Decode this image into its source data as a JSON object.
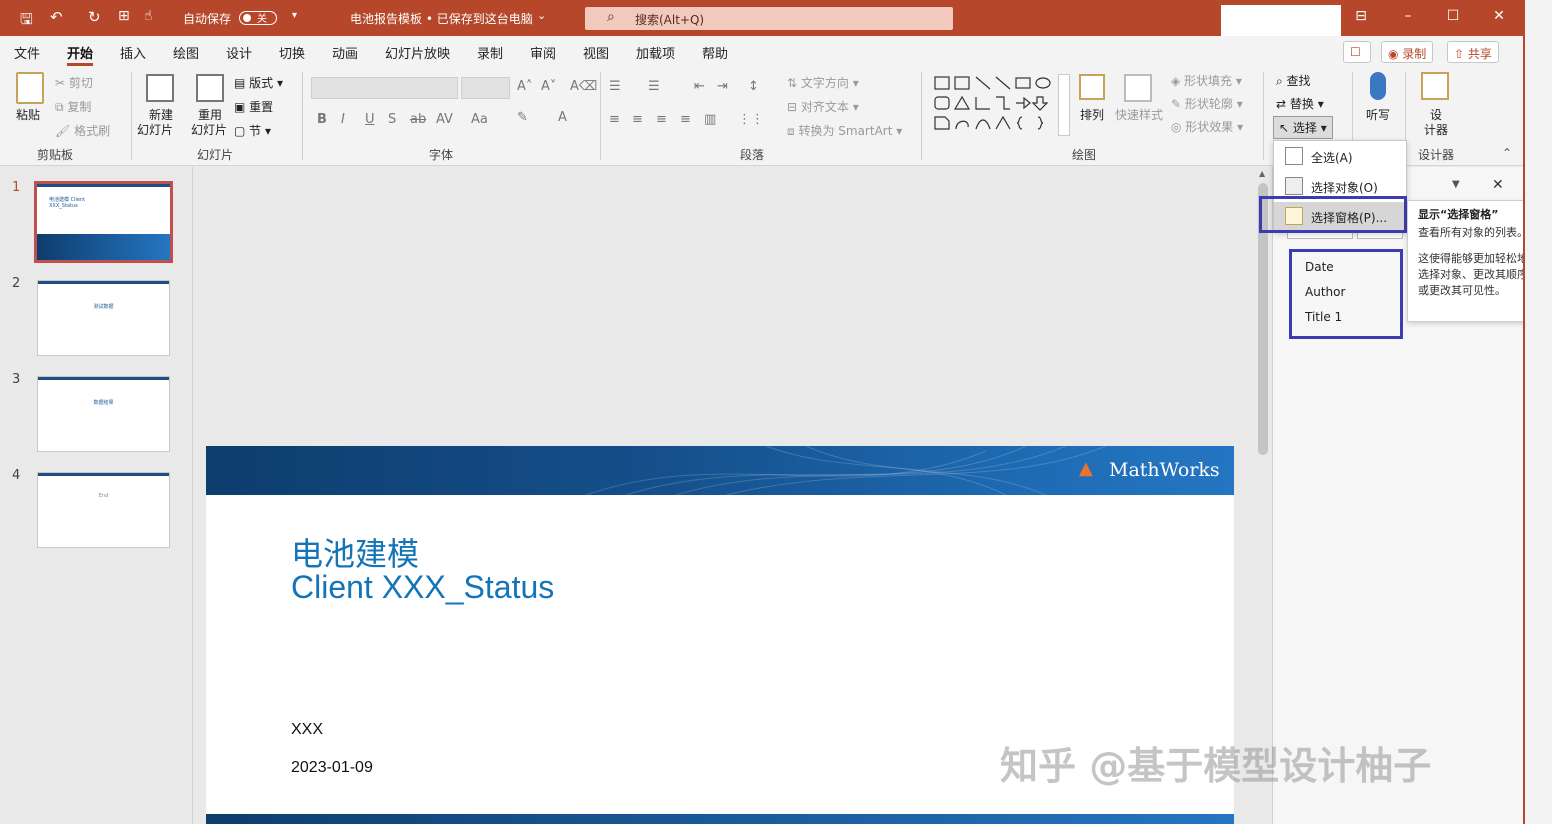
{
  "titlebar": {
    "autosave_label": "自动保存",
    "autosave_state": "关",
    "doc_title": "电池报告模板 • 已保存到这台电脑",
    "search_placeholder": "搜索(Alt+Q)"
  },
  "menu": {
    "tabs": [
      "文件",
      "开始",
      "插入",
      "绘图",
      "设计",
      "切换",
      "动画",
      "幻灯片放映",
      "录制",
      "审阅",
      "视图",
      "加载项",
      "帮助"
    ],
    "active_tab": "开始",
    "record_button": "录制",
    "share_button": "共享"
  },
  "ribbon": {
    "clipboard": {
      "paste": "粘贴",
      "cut": "剪切",
      "copy": "复制",
      "format_painter": "格式刷",
      "group": "剪贴板"
    },
    "slides": {
      "new_slide_1": "新建",
      "new_slide_2": "幻灯片",
      "reuse_1": "重用",
      "reuse_2": "幻灯片",
      "layout": "版式",
      "reset": "重置",
      "section": "节",
      "group": "幻灯片"
    },
    "font": {
      "group": "字体"
    },
    "paragraph": {
      "text_direction": "文字方向",
      "align_text": "对齐文本",
      "convert_smartart": "转换为 SmartArt",
      "group": "段落"
    },
    "drawing": {
      "arrange": "排列",
      "quick_styles": "快速样式",
      "shape_fill": "形状填充",
      "shape_outline": "形状轮廓",
      "shape_effects": "形状效果",
      "group": "绘图"
    },
    "editing": {
      "find": "查找",
      "replace": "替换",
      "select": "选择"
    },
    "voice": {
      "dictate": "听写"
    },
    "designer": {
      "label_1": "设",
      "label_2": "计器",
      "group": "设计器"
    }
  },
  "thumbnails": [
    {
      "num": "1",
      "text": "电池建模 Client XXX_Status"
    },
    {
      "num": "2",
      "text": "测试数据"
    },
    {
      "num": "3",
      "text": "数据结果"
    },
    {
      "num": "4",
      "text": "End"
    }
  ],
  "slide": {
    "title_line1": "电池建模",
    "title_line2": "Client XXX_Status",
    "author": "XXX",
    "date": "2023-01-09",
    "logo": "MathWorks"
  },
  "select_menu": {
    "select_all": "全选(A)",
    "select_objects": "选择对象(O)",
    "selection_pane": "选择窗格(P)..."
  },
  "tooltip": {
    "title": "显示“选择窗格”",
    "line1": "查看所有对象的列表。",
    "line2": "这使得能够更加轻松地选择对象、更改其顺序或更改其可见性。"
  },
  "selection_list": [
    "Date",
    "Author",
    "Title 1"
  ],
  "watermark": "知乎 @基于模型设计柚子"
}
